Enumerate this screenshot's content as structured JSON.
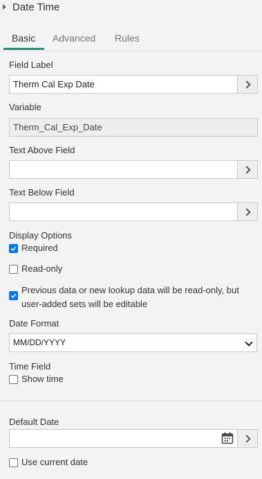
{
  "panel": {
    "title": "Date Time"
  },
  "tabs": [
    {
      "label": "Basic"
    },
    {
      "label": "Advanced"
    },
    {
      "label": "Rules"
    }
  ],
  "fields": {
    "field_label": {
      "label": "Field Label",
      "value": "Therm Cal Exp Date"
    },
    "variable": {
      "label": "Variable",
      "value": "Therm_Cal_Exp_Date"
    },
    "text_above": {
      "label": "Text Above Field",
      "value": ""
    },
    "text_below": {
      "label": "Text Below Field",
      "value": ""
    }
  },
  "display_options": {
    "label": "Display Options",
    "required": {
      "label": "Required",
      "checked": true
    },
    "read_only": {
      "label": "Read-only",
      "checked": false
    },
    "previous_data": {
      "label": "Previous data or new lookup data will be read-only, but user-added sets will be editable",
      "checked": true
    }
  },
  "date_format": {
    "label": "Date Format",
    "selected": "MM/DD/YYYY"
  },
  "time_field": {
    "label": "Time Field",
    "show_time": {
      "label": "Show time",
      "checked": false
    }
  },
  "default_date": {
    "label": "Default Date",
    "value": "",
    "use_current": {
      "label": "Use current date",
      "checked": false
    }
  },
  "colors": {
    "accent": "#1a8f7a",
    "checkbox": "#0075ff"
  }
}
